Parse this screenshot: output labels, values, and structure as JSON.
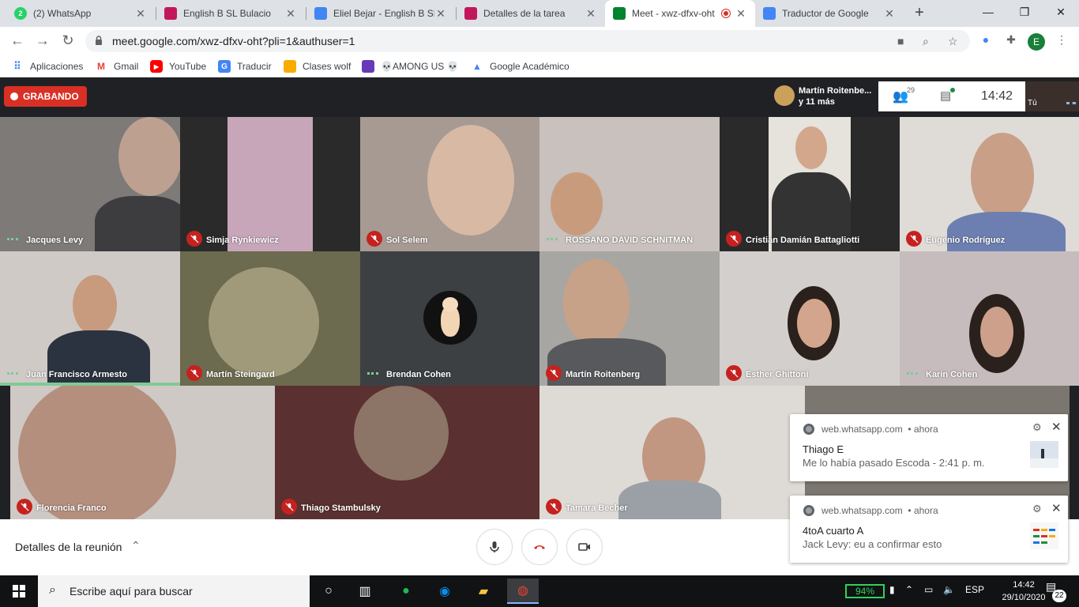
{
  "tabs": [
    {
      "title": "(2) WhatsApp",
      "badge": "2",
      "close": "✕"
    },
    {
      "title": "English B SL Bulacio",
      "close": "✕"
    },
    {
      "title": "Eliel Bejar - English B SL",
      "close": "✕"
    },
    {
      "title": "Detalles de la tarea",
      "close": "✕"
    },
    {
      "title": "Meet - xwz-dfxv-oht",
      "close": "✕"
    },
    {
      "title": "Traductor de Google",
      "close": "✕"
    }
  ],
  "address_bar": {
    "url": "meet.google.com/xwz-dfxv-oht?pli=1&authuser=1",
    "profile_initial": "E"
  },
  "bookmarks": [
    "Aplicaciones",
    "Gmail",
    "YouTube",
    "Traducir",
    "Clases wolf",
    "💀AMONG US 💀",
    "Google Académico"
  ],
  "meet": {
    "recording_label": "GRABANDO",
    "presenter_line1": "Martín Roitenbe...",
    "presenter_line2": "y 11 más",
    "participant_count": "29",
    "clock": "14:42",
    "self_label": "Tú",
    "details_label": "Detalles de la reunión",
    "participants": [
      {
        "name": "Jacques Levy",
        "muted": false
      },
      {
        "name": "Simja Rynkiewicz",
        "muted": true
      },
      {
        "name": "Sol Selem",
        "muted": true
      },
      {
        "name": "ROSSANO DAVID SCHNITMAN",
        "muted": false
      },
      {
        "name": "Cristian Damián Battagliotti",
        "muted": true
      },
      {
        "name": "Eugenio Rodríguez",
        "muted": true
      },
      {
        "name": "Juan Francisco Armesto",
        "muted": false
      },
      {
        "name": "Martín Steingard",
        "muted": true
      },
      {
        "name": "Brendan Cohen",
        "muted": false
      },
      {
        "name": "Martín Roitenberg",
        "muted": true
      },
      {
        "name": "Esther Ghittoni",
        "muted": true
      },
      {
        "name": "Karin Cohen",
        "muted": false
      },
      {
        "name": "Florencia Franco",
        "muted": true
      },
      {
        "name": "Thiago Stambulsky",
        "muted": true
      },
      {
        "name": "Tamara Becher",
        "muted": true
      }
    ]
  },
  "notifications": [
    {
      "source": "web.whatsapp.com",
      "time": "• ahora",
      "title": "Thiago E",
      "message": "Me lo había pasado Escoda - 2:41 p. m."
    },
    {
      "source": "web.whatsapp.com",
      "time": "• ahora",
      "title": "4toA cuarto A",
      "message": "Jack Levy: eu a confirmar esto"
    }
  ],
  "taskbar": {
    "search_placeholder": "Escribe aquí para buscar",
    "battery": "94%",
    "language": "ESP",
    "time": "14:42",
    "date": "29/10/2020",
    "notification_count": "22"
  },
  "colors": {
    "accent": "#1a73e8",
    "record": "#d93025",
    "mute": "#c5221f",
    "speaking": "#81c995",
    "taskbar": "#101214"
  }
}
